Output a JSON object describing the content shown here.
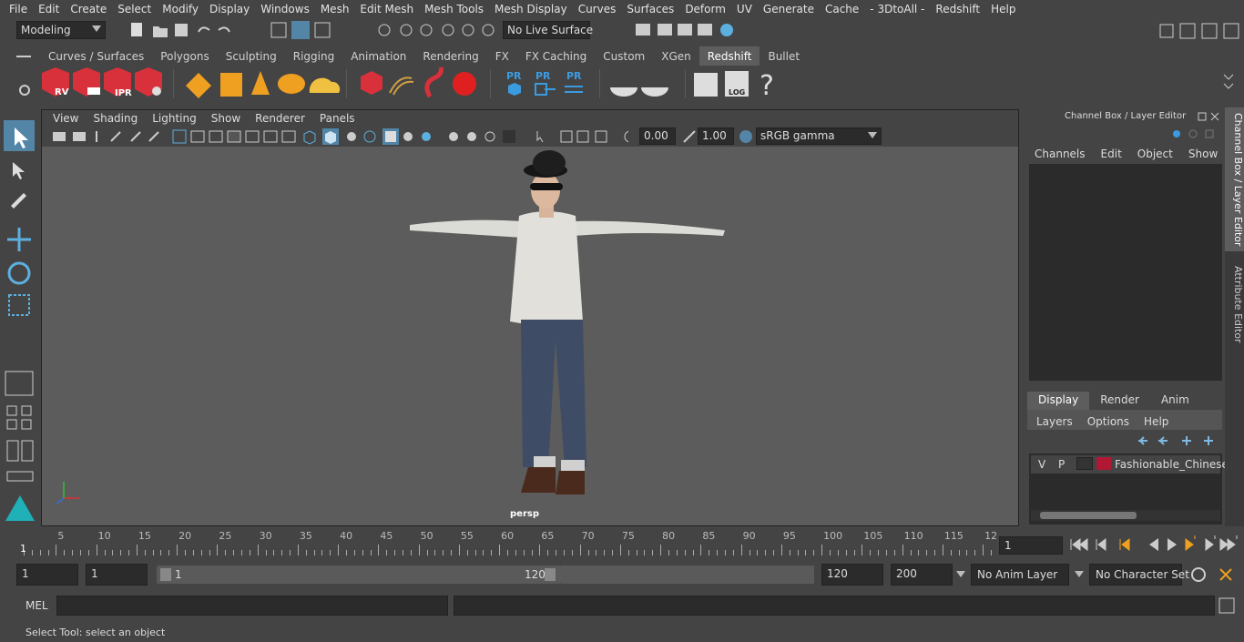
{
  "menubar": {
    "items": [
      "File",
      "Edit",
      "Create",
      "Select",
      "Modify",
      "Display",
      "Windows",
      "Mesh",
      "Edit Mesh",
      "Mesh Tools",
      "Mesh Display",
      "Curves",
      "Surfaces",
      "Deform",
      "UV",
      "Generate",
      "Cache",
      "- 3DtoAll -",
      "Redshift",
      "Help"
    ]
  },
  "statusline": {
    "mode": "Modeling",
    "live_surface": "No Live Surface"
  },
  "shelf": {
    "tabs": [
      "Curves / Surfaces",
      "Polygons",
      "Sculpting",
      "Rigging",
      "Animation",
      "Rendering",
      "FX",
      "FX Caching",
      "Custom",
      "XGen",
      "Redshift",
      "Bullet"
    ],
    "active_tab": "Redshift",
    "icons": {
      "rv": "RV",
      "ipr": "IPR",
      "pr": "PR",
      "log": "LOG",
      "help": "?"
    }
  },
  "viewport": {
    "menu": [
      "View",
      "Shading",
      "Lighting",
      "Show",
      "Renderer",
      "Panels"
    ],
    "exposure": "0.00",
    "gamma": "1.00",
    "color_space": "sRGB gamma",
    "camera_label": "persp"
  },
  "channelbox": {
    "title": "Channel Box / Layer Editor",
    "menu": [
      "Channels",
      "Edit",
      "Object",
      "Show"
    ]
  },
  "layereditor": {
    "tabs": [
      "Display",
      "Render",
      "Anim"
    ],
    "active_tab": "Display",
    "menu": [
      "Layers",
      "Options",
      "Help"
    ],
    "layer": {
      "visible": "V",
      "playback": "P",
      "name": "Fashionable_Chinese_",
      "color": "#b01834"
    }
  },
  "sidetabs": [
    "Channel Box / Layer Editor",
    "Attribute Editor"
  ],
  "timeline": {
    "labels": [
      "5",
      "10",
      "15",
      "20",
      "25",
      "30",
      "35",
      "40",
      "45",
      "50",
      "55",
      "60",
      "65",
      "70",
      "75",
      "80",
      "85",
      "90",
      "95",
      "100",
      "105",
      "110",
      "115",
      "12"
    ],
    "start_marker": "1",
    "current_frame": "1"
  },
  "range": {
    "start": "1",
    "playback_start": "1",
    "slider_start": "1",
    "slider_end": "120",
    "playback_end": "120",
    "end": "200",
    "anim_layer": "No Anim Layer",
    "character_set": "No Character Set"
  },
  "cmdline": {
    "lang": "MEL"
  },
  "helpline": {
    "text": "Select Tool: select an object"
  },
  "colors": {
    "accent": "#5285a6",
    "active_tab": "#5d5d5d",
    "viewport_bg": "#5c5c5c",
    "panel": "#444444"
  }
}
